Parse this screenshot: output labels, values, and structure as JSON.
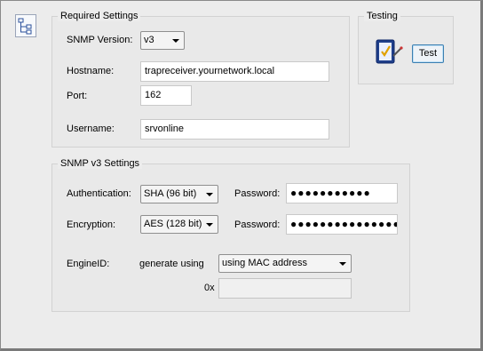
{
  "required": {
    "title": "Required Settings",
    "snmp_version_label": "SNMP Version:",
    "snmp_version_value": "v3",
    "hostname_label": "Hostname:",
    "hostname_value": "trapreceiver.yournetwork.local",
    "port_label": "Port:",
    "port_value": "162",
    "username_label": "Username:",
    "username_value": "srvonline"
  },
  "testing": {
    "title": "Testing",
    "test_button": "Test"
  },
  "v3": {
    "title": "SNMP v3 Settings",
    "auth_label": "Authentication:",
    "auth_value": "SHA (96 bit)",
    "auth_password_label": "Password:",
    "auth_password_value": "●●●●●●●●●●●",
    "enc_label": "Encryption:",
    "enc_value": "AES (128 bit)",
    "enc_password_label": "Password:",
    "enc_password_value": "●●●●●●●●●●●●●●●",
    "engine_label": "EngineID:",
    "generate_label": "generate using",
    "generate_value": "using MAC address",
    "hex_prefix": "0x",
    "engine_value": ""
  },
  "icons": [
    "network-tree-icon",
    "clipboard-check-icon",
    "chevron-down-icon"
  ]
}
